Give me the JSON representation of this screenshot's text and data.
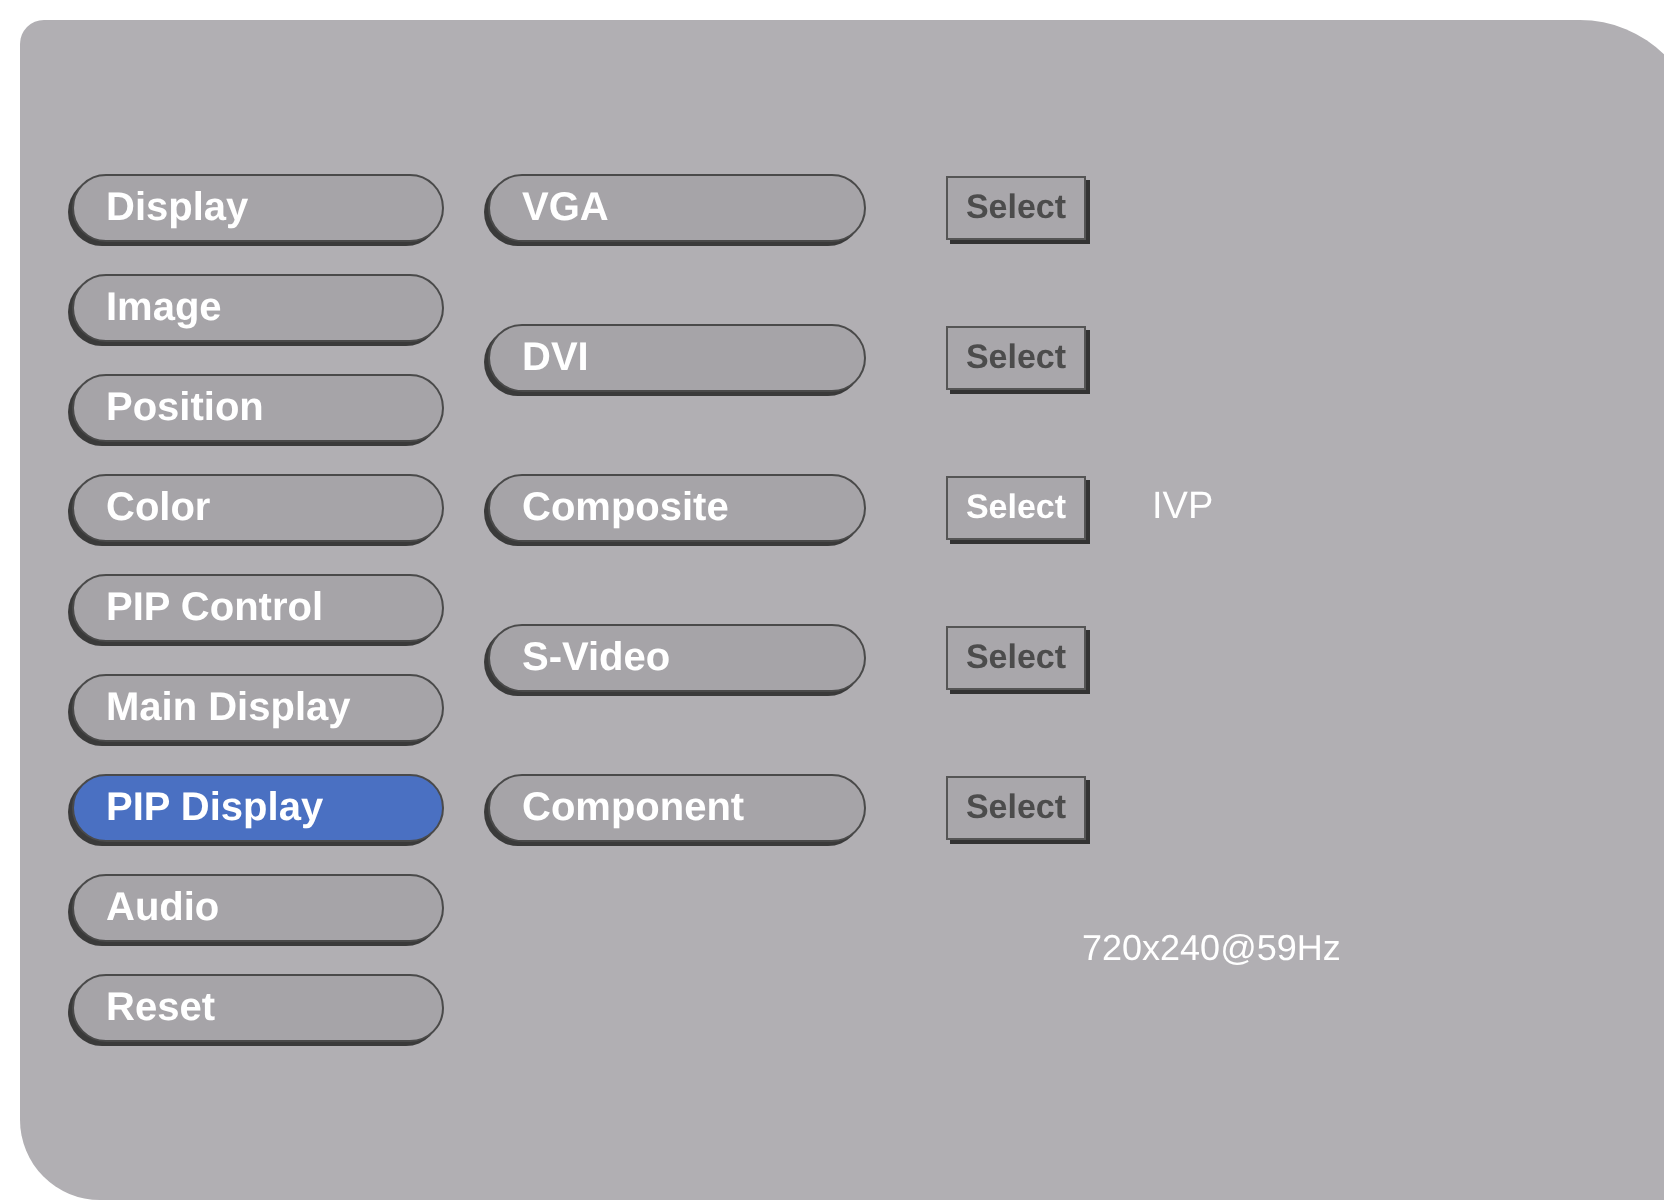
{
  "menu": [
    {
      "label": "Display",
      "selected": false
    },
    {
      "label": "Image",
      "selected": false
    },
    {
      "label": "Position",
      "selected": false
    },
    {
      "label": "Color",
      "selected": false
    },
    {
      "label": "PIP Control",
      "selected": false
    },
    {
      "label": "Main Display",
      "selected": false
    },
    {
      "label": "PIP Display",
      "selected": true
    },
    {
      "label": "Audio",
      "selected": false
    },
    {
      "label": "Reset",
      "selected": false
    }
  ],
  "sources": [
    {
      "label": "VGA",
      "button": "Select",
      "selected": false
    },
    {
      "label": "DVI",
      "button": "Select",
      "selected": false
    },
    {
      "label": "Composite",
      "button": "Select",
      "selected": true,
      "note": "IVP"
    },
    {
      "label": "S-Video",
      "button": "Select",
      "selected": false
    },
    {
      "label": "Component",
      "button": "Select",
      "selected": false
    }
  ],
  "resolution": "720x240@59Hz"
}
